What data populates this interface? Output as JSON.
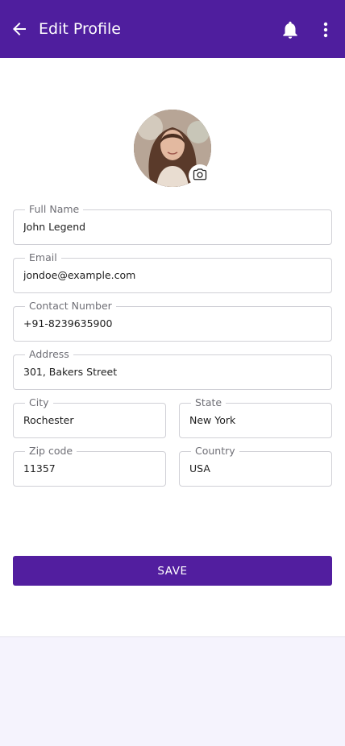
{
  "appbar": {
    "title": "Edit Profile",
    "back_icon": "arrow-left-icon",
    "notification_icon": "bell-icon",
    "menu_icon": "more-vertical-icon",
    "background_color": "#4f1e9e"
  },
  "avatar": {
    "camera_icon": "camera-icon"
  },
  "form": {
    "full_name": {
      "label": "Full Name",
      "value": "John Legend"
    },
    "email": {
      "label": "Email",
      "value": "jondoe@example.com"
    },
    "contact": {
      "label": "Contact Number",
      "value": "+91-8239635900"
    },
    "address": {
      "label": "Address",
      "value": "301, Bakers Street"
    },
    "city": {
      "label": "City",
      "value": "Rochester"
    },
    "state": {
      "label": "State",
      "value": "New York"
    },
    "zip": {
      "label": "Zip code",
      "value": "11357"
    },
    "country": {
      "label": "Country",
      "value": "USA"
    }
  },
  "actions": {
    "save_label": "SAVE",
    "accent_color": "#521e9f"
  }
}
